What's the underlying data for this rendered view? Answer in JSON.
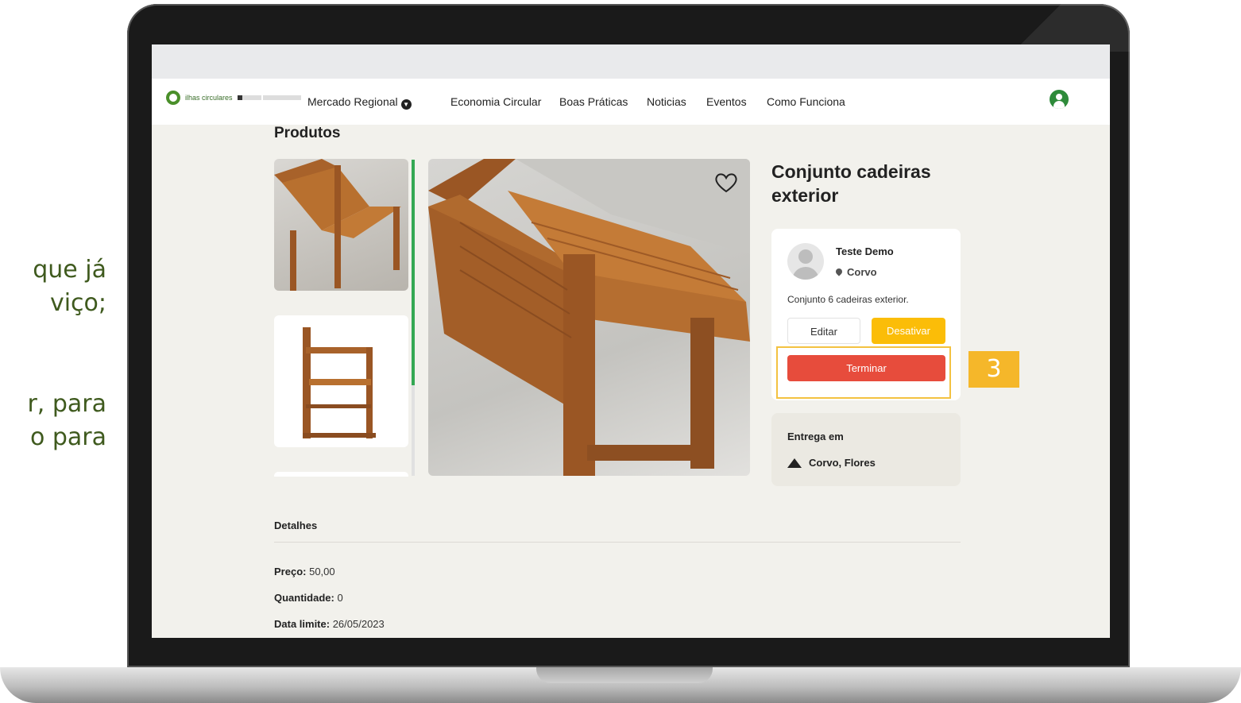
{
  "side_text": {
    "line1": "que já",
    "line2": "viço;",
    "line3": "r, para",
    "line4": "o para"
  },
  "nav": {
    "logo_text": "ilhas circulares",
    "items": [
      "Mercado Regional",
      "Economia Circular",
      "Boas Práticas",
      "Noticias",
      "Eventos",
      "Como Funciona"
    ]
  },
  "page": {
    "section_title": "Produtos"
  },
  "product": {
    "title": "Conjunto cadeiras exterior",
    "seller": {
      "name": "Teste Demo",
      "location": "Corvo",
      "description": "Conjunto 6 cadeiras exterior."
    },
    "buttons": {
      "edit": "Editar",
      "deactivate": "Desativar",
      "finish": "Terminar"
    },
    "step_badge": "3",
    "delivery": {
      "title": "Entrega em",
      "places": "Corvo, Flores"
    }
  },
  "details": {
    "title": "Detalhes",
    "price_label": "Preço:",
    "price_value": "50,00",
    "quantity_label": "Quantidade:",
    "quantity_value": "0",
    "deadline_label": "Data limite:",
    "deadline_value": "26/05/2023"
  },
  "colors": {
    "accent_green": "#34a853",
    "warning_yellow": "#fbbd08",
    "danger_red": "#e74c3c",
    "highlight": "#f3c241"
  },
  "icons": [
    "user-icon",
    "heart-icon",
    "pin-icon",
    "mountain-icon",
    "chevron-down-icon"
  ]
}
